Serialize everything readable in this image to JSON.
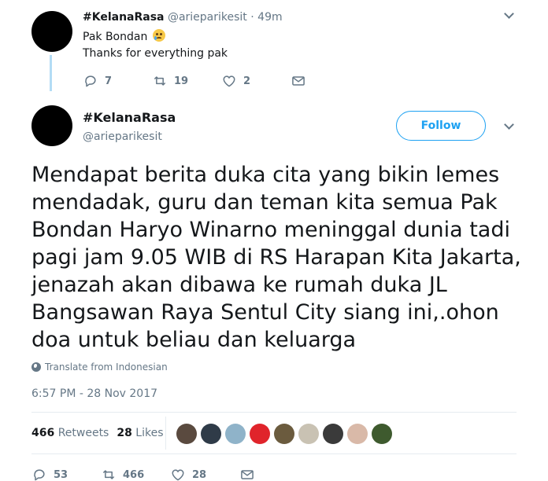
{
  "parent_tweet": {
    "display_name": "#KelanaRasa",
    "handle": "@arieparikesit",
    "separator": "·",
    "time": "49m",
    "line1": "Pak Bondan",
    "emoji": "sad-tear-emoji",
    "line2": "Thanks for everything pak",
    "actions": {
      "replies": "7",
      "retweets": "19",
      "likes": "2"
    }
  },
  "main_tweet": {
    "display_name": "#KelanaRasa",
    "handle": "@arieparikesit",
    "follow_label": "Follow",
    "text_lines": [
      "Mendapat berita duka cita yang bikin lemes",
      "mendadak, guru dan teman kita semua Pak",
      "Bondan Haryo Winarno meninggal dunia tadi",
      "pagi jam 9.05 WIB di RS Harapan Kita Jakarta,",
      "jenazah akan dibawa ke rumah duka JL",
      "Bangsawan Raya Sentul City siang ini,.ohon",
      "doa untuk beliau dan keluarga"
    ],
    "translate_label": "Translate from Indonesian",
    "timestamp": "6:57 PM - 28 Nov 2017",
    "stats": {
      "retweets_count": "466",
      "retweets_label": "Retweets",
      "likes_count": "28",
      "likes_label": "Likes"
    },
    "likers": [
      {
        "name": "liker-avatar-1",
        "color": "#5a4a3f"
      },
      {
        "name": "liker-avatar-2",
        "color": "#2f3b48"
      },
      {
        "name": "liker-avatar-3",
        "color": "#8fb3c9"
      },
      {
        "name": "liker-avatar-4",
        "color": "#e0242b"
      },
      {
        "name": "liker-avatar-5",
        "color": "#6b5b3e"
      },
      {
        "name": "liker-avatar-6",
        "color": "#c9c2b3"
      },
      {
        "name": "liker-avatar-7",
        "color": "#3a3a3a"
      },
      {
        "name": "liker-avatar-8",
        "color": "#d9b9a8"
      },
      {
        "name": "liker-avatar-9",
        "color": "#3e5a2e"
      }
    ],
    "actions": {
      "replies": "53",
      "retweets": "466",
      "likes": "28"
    }
  },
  "colors": {
    "accent": "#1da1f2",
    "muted": "#657786",
    "thread_line": "#b3dcf5"
  }
}
